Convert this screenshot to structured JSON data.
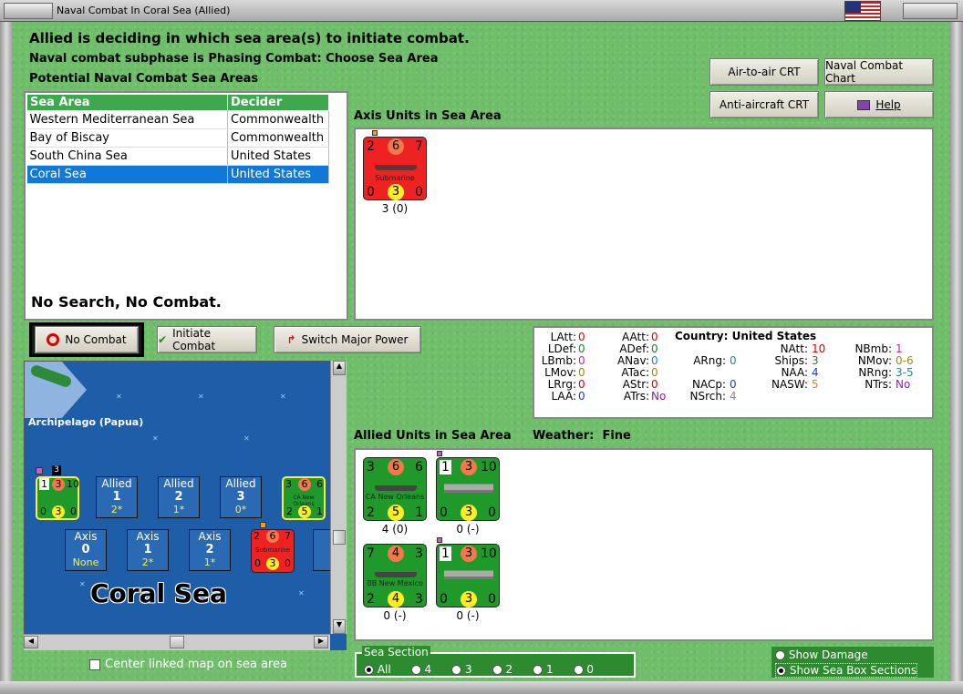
{
  "window": {
    "title": "Naval Combat In Coral Sea (Allied)"
  },
  "status": {
    "line1": "Allied is deciding in which sea area(s) to initiate combat.",
    "line2": "Naval combat subphase is Phasing Combat: Choose Sea Area",
    "line3": "Potential Naval Combat Sea Areas"
  },
  "sea_table": {
    "headers": [
      "Sea Area",
      "Decider"
    ],
    "rows": [
      {
        "area": "Western Mediterranean Sea",
        "decider": "Commonwealth"
      },
      {
        "area": "Bay of Biscay",
        "decider": "Commonwealth"
      },
      {
        "area": "South China Sea",
        "decider": "United States"
      },
      {
        "area": "Coral Sea",
        "decider": "United States"
      }
    ],
    "selected_index": 3
  },
  "no_search_msg": "No Search, No Combat.",
  "buttons": {
    "air_to_air": "Air-to-air CRT",
    "naval_chart": "Naval Combat Chart",
    "anti_aircraft": "Anti-aircraft CRT",
    "help": "Help",
    "no_combat": "No Combat",
    "initiate_combat": "Initiate Combat",
    "switch_major_power": "Switch Major Power"
  },
  "axis_units": {
    "heading": "Axis Units in Sea Area",
    "units": [
      {
        "top": [
          "2",
          "6",
          "7"
        ],
        "bottom": [
          "0",
          "3",
          "0"
        ],
        "name": "Submarine",
        "label": "3 (0)"
      }
    ]
  },
  "allied_units": {
    "heading": "Allied Units in Sea Area",
    "weather_label": "Weather:",
    "weather_value": "Fine",
    "units": [
      {
        "top": [
          "3",
          "6",
          "6"
        ],
        "bottom": [
          "2",
          "5",
          "1"
        ],
        "name": "CA New Orleans",
        "label": "4 (0)"
      },
      {
        "top": [
          "1",
          "3",
          "10"
        ],
        "bottom": [
          "0",
          "3",
          "0"
        ],
        "name": "",
        "label": "0 (-)"
      },
      {
        "top": [
          "7",
          "4",
          "3"
        ],
        "bottom": [
          "2",
          "4",
          "3"
        ],
        "name": "BB New Mexico",
        "label": "0 (-)"
      },
      {
        "top": [
          "1",
          "3",
          "10"
        ],
        "bottom": [
          "0",
          "3",
          "0"
        ],
        "name": "",
        "label": "0 (-)"
      }
    ]
  },
  "stats": {
    "country_label": "Country:",
    "country": "United States",
    "col1": [
      [
        "LAtt:",
        "0"
      ],
      [
        "LDef:",
        "0"
      ],
      [
        "LBmb:",
        "0"
      ],
      [
        "LMov:",
        "0"
      ],
      [
        "LRrg:",
        "0"
      ],
      [
        "LAA:",
        "0"
      ]
    ],
    "col2": [
      [
        "AAtt:",
        "0"
      ],
      [
        "ADef:",
        "0"
      ],
      [
        "ANav:",
        "0"
      ],
      [
        "ATac:",
        "0"
      ],
      [
        "AStr:",
        "0"
      ],
      [
        "ATrs:",
        "No"
      ]
    ],
    "col3": [
      [
        "ARng:",
        "0"
      ],
      [
        "NACp:",
        "0"
      ],
      [
        "NSrch:",
        "4"
      ]
    ],
    "col4": [
      [
        "NAtt:",
        "10"
      ],
      [
        "Ships:",
        "3"
      ],
      [
        "NAA:",
        "4"
      ],
      [
        "NASW:",
        "5"
      ]
    ],
    "col5": [
      [
        "NBmb:",
        "1"
      ],
      [
        "NMov:",
        "0-6"
      ],
      [
        "NRng:",
        "3-5"
      ],
      [
        "NTrs:",
        "No"
      ]
    ]
  },
  "map": {
    "region_label": "Archipelago (Papua)",
    "sea_name": "Coral Sea",
    "stack_count": "3",
    "allied_boxes": [
      {
        "title": "Allied",
        "num": "1",
        "val": "2*"
      },
      {
        "title": "Allied",
        "num": "2",
        "val": "1*"
      },
      {
        "title": "Allied",
        "num": "3",
        "val": "0*"
      }
    ],
    "axis_boxes": [
      {
        "title": "Axis",
        "num": "0",
        "val": "None"
      },
      {
        "title": "Axis",
        "num": "1",
        "val": "2*"
      },
      {
        "title": "Axis",
        "num": "2",
        "val": "1*"
      },
      {
        "title": "A",
        "num": "",
        "val": ""
      }
    ],
    "map_counters": [
      {
        "top": [
          "1",
          "3",
          "10"
        ],
        "bottom": [
          "0",
          "3",
          "0"
        ],
        "name": ""
      },
      {
        "top": [
          "3",
          "6",
          "6"
        ],
        "bottom": [
          "2",
          "5",
          "1"
        ],
        "name": "CA New Orleans"
      },
      {
        "top": [
          "2",
          "6",
          "7"
        ],
        "bottom": [
          "0",
          "3",
          "0"
        ],
        "name": "Submarine"
      }
    ]
  },
  "center_linked": "Center linked map on sea area",
  "sea_section": {
    "label": "Sea Section",
    "options": [
      "All",
      "4",
      "3",
      "2",
      "1",
      "0"
    ],
    "selected": "All"
  },
  "show_options": {
    "damage": "Show Damage",
    "sections": "Show Sea Box Sections",
    "selected": "Show Sea Box Sections"
  },
  "colors": {
    "allied_counter": "#1f9a2a",
    "axis_counter": "#e82020",
    "selected_row": "#1078d8",
    "header_green": "#3ea84f"
  }
}
